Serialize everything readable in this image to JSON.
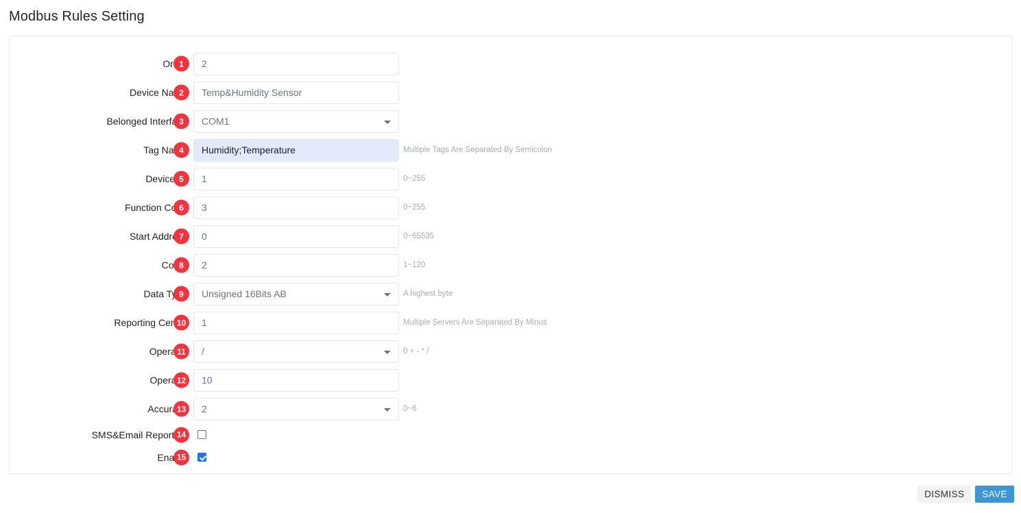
{
  "page": {
    "title": "Modbus Rules Setting"
  },
  "form": {
    "rows": [
      {
        "badge": "1",
        "label": "Order",
        "type": "text",
        "value": "2",
        "hint": ""
      },
      {
        "badge": "2",
        "label": "Device Name",
        "type": "text",
        "value": "Temp&Humidity Sensor",
        "hint": ""
      },
      {
        "badge": "3",
        "label": "Belonged Interface",
        "type": "select",
        "value": "COM1",
        "hint": ""
      },
      {
        "badge": "4",
        "label": "Tag Name",
        "type": "text",
        "value": "Humidity;Temperature",
        "hint": "Multiple Tags Are Separated By Semicolon",
        "highlight": true
      },
      {
        "badge": "5",
        "label": "Device ID",
        "type": "text",
        "value": "1",
        "hint": "0~255"
      },
      {
        "badge": "6",
        "label": "Function Code",
        "type": "text",
        "value": "3",
        "hint": "0~255"
      },
      {
        "badge": "7",
        "label": "Start Address",
        "type": "text",
        "value": "0",
        "hint": "0~65535"
      },
      {
        "badge": "8",
        "label": "Count",
        "type": "text",
        "value": "2",
        "hint": "1~120"
      },
      {
        "badge": "9",
        "label": "Data Type",
        "type": "select",
        "value": "Unsigned 16Bits AB",
        "hint": "A highest byte"
      },
      {
        "badge": "10",
        "label": "Reporting Center",
        "type": "text",
        "value": "1",
        "hint": "Multiple Servers Are Separated By Minus"
      },
      {
        "badge": "11",
        "label": "Operator",
        "type": "select",
        "value": "/",
        "hint": "0 + - * /"
      },
      {
        "badge": "12",
        "label": "Operand",
        "type": "text",
        "value": "10",
        "hint": ""
      },
      {
        "badge": "13",
        "label": "Accuracy",
        "type": "select",
        "value": "2",
        "hint": "0~6"
      },
      {
        "badge": "14",
        "label": "SMS&Email Reporting",
        "type": "checkbox",
        "checked": false,
        "hint": ""
      },
      {
        "badge": "15",
        "label": "Enable",
        "type": "checkbox",
        "checked": true,
        "hint": ""
      }
    ]
  },
  "footer": {
    "dismiss_label": "DISMISS",
    "save_label": "SAVE"
  },
  "colors": {
    "badge": "#f5333f",
    "save_button": "#3b97d3",
    "dismiss_button": "#f2f2f2",
    "highlight_field": "#e2eafc",
    "checkbox_checked": "#1a73e8"
  }
}
